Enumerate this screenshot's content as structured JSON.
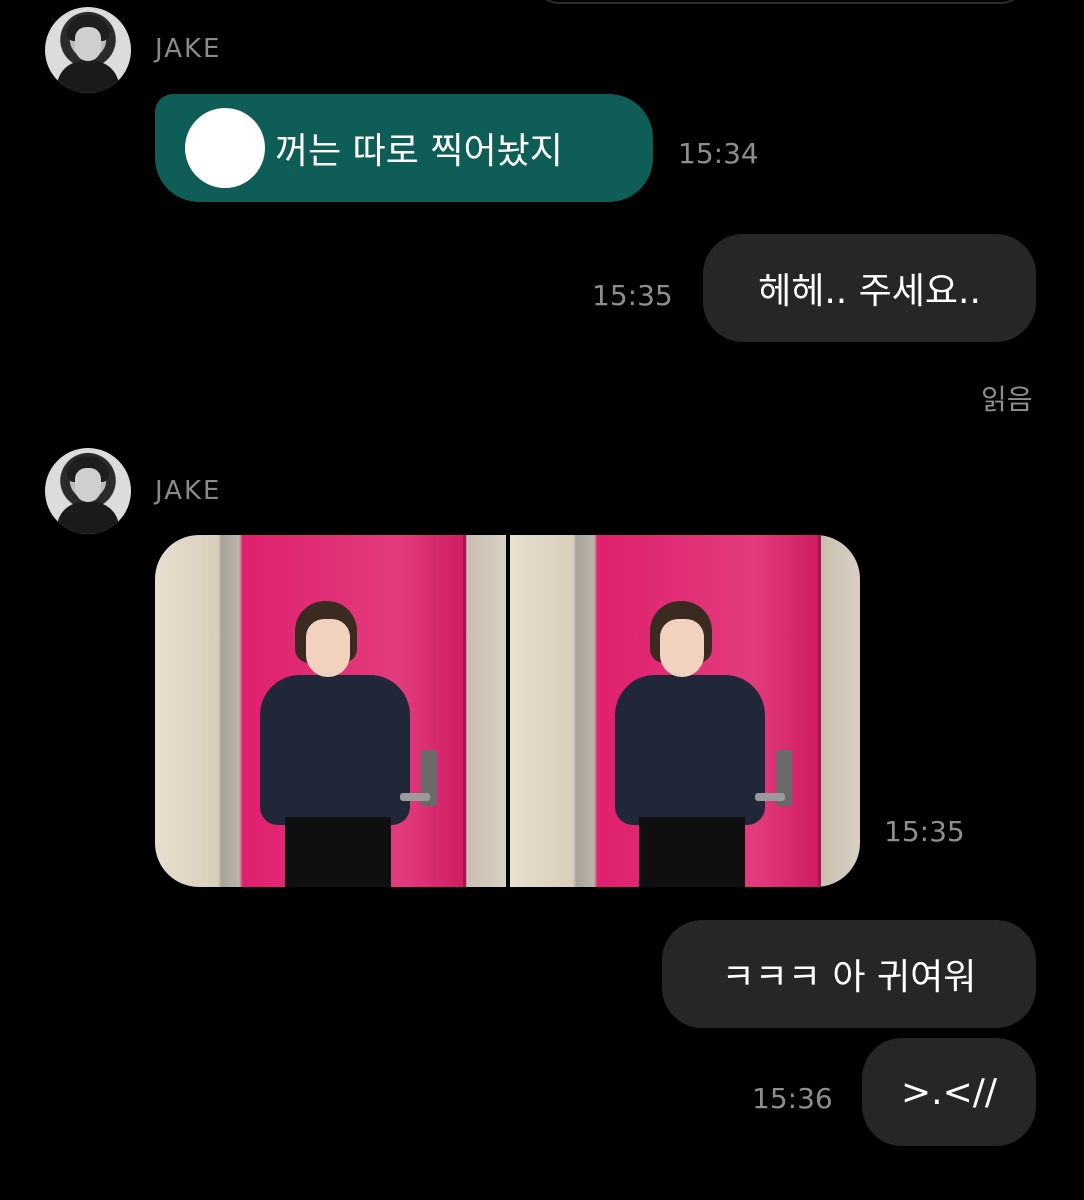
{
  "messages": [
    {
      "sender": "JAKE",
      "text": "꺼는 따로 찍어놨지",
      "time": "15:34"
    },
    {
      "text": "헤헤.. 주세요..",
      "time": "15:35",
      "status": "읽음"
    },
    {
      "sender": "JAKE",
      "attachment": "photo-pair",
      "time": "15:35"
    },
    {
      "text": "ㅋㅋㅋ 아 귀여워"
    },
    {
      "text": ">.<//",
      "time": "15:36"
    }
  ]
}
